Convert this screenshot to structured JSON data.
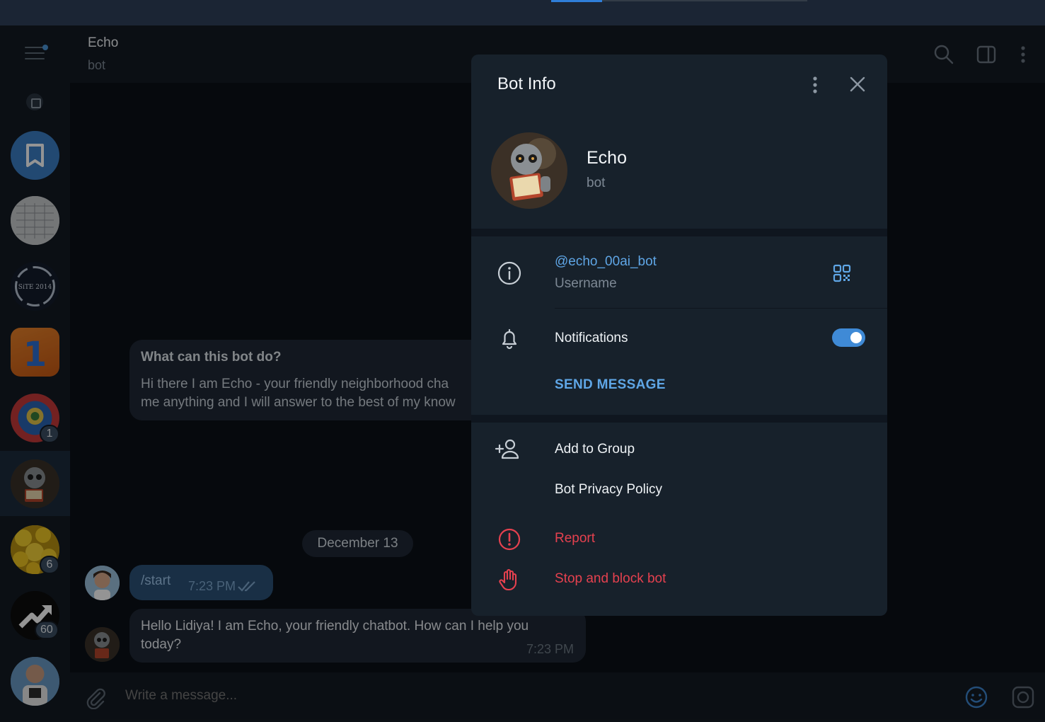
{
  "chat": {
    "title": "Echo",
    "subtitle": "bot"
  },
  "sidebar": {
    "badges": [
      "1",
      "6",
      "60"
    ]
  },
  "messages": {
    "intro_title": "What can this bot do?",
    "intro_line1": "Hi there I am Echo -  your friendly neighborhood cha",
    "intro_line2": "me anything and I will answer to the best of my know",
    "date": "December 13",
    "out_text": "/start",
    "out_time": "7:23 PM",
    "in_line1": "Hello Lidiya! I am Echo, your friendly chatbot. How can I help you",
    "in_line2": "today?",
    "in_time": "7:23 PM"
  },
  "composer": {
    "placeholder": "Write a message..."
  },
  "modal": {
    "title": "Bot Info",
    "name": "Echo",
    "subtitle": "bot",
    "username": "@echo_00ai_bot",
    "username_label": "Username",
    "notifications_label": "Notifications",
    "notifications_on": true,
    "send_message": "SEND MESSAGE",
    "add_to_group": "Add to Group",
    "privacy_policy": "Bot Privacy Policy",
    "report": "Report",
    "stop_block": "Stop and block bot"
  },
  "colors": {
    "accent": "#5fa6e6",
    "danger": "#e5414f",
    "outgoing_bubble": "#2b5278",
    "toggle": "#3f8ad6"
  },
  "icons": [
    "menu-icon",
    "archive-icon",
    "bookmark-icon",
    "search-icon",
    "sidebar-toggle-icon",
    "more-vertical-icon",
    "close-icon",
    "info-icon",
    "qr-code-icon",
    "bell-icon",
    "add-user-icon",
    "report-icon",
    "hand-stop-icon",
    "attach-icon",
    "emoji-icon",
    "sticker-icon",
    "double-check-icon"
  ]
}
